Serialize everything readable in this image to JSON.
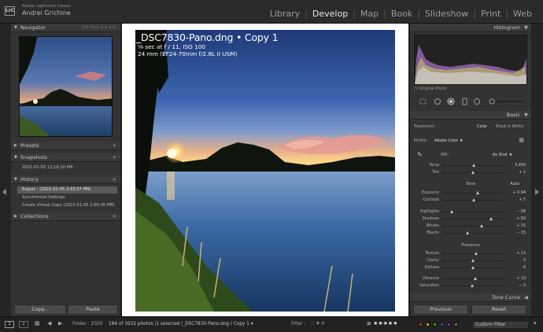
{
  "app": {
    "name": "Adobe Lightroom Classic",
    "user": "Andrei Grichine",
    "logo": "LrC"
  },
  "modules": [
    {
      "label": "Library",
      "active": false
    },
    {
      "label": "Develop",
      "active": true
    },
    {
      "label": "Map",
      "active": false
    },
    {
      "label": "Book",
      "active": false
    },
    {
      "label": "Slideshow",
      "active": false
    },
    {
      "label": "Print",
      "active": false
    },
    {
      "label": "Web",
      "active": false
    }
  ],
  "left": {
    "navigator": {
      "title": "Navigator",
      "options": "FIT   FILL   1:1   4:1"
    },
    "presets": {
      "title": "Presets"
    },
    "snapshots": {
      "title": "Snapshots",
      "items": [
        "2021-01-05 12:18:10 PM"
      ]
    },
    "history": {
      "title": "History",
      "items": [
        "Export - (2021-01-05 2:43:57 PM)",
        "Synchronize Settings",
        "Create Virtual Copy (2021-01-05 2:00:36 PM)"
      ]
    },
    "collections": {
      "title": "Collections"
    },
    "copy_label": "Copy...",
    "paste_label": "Paste"
  },
  "photo": {
    "line1": "_DSC7830-Pano.dng  •  Copy 1",
    "line2": "¹⁄₉ sec at f / 11, ISO 100",
    "line3": "24 mm (EF24-70mm f/2.8L II USM)"
  },
  "right": {
    "histogram": {
      "title": "Histogram",
      "iso": "ISO 100",
      "focal": "24 mm",
      "aperture": "f / 11",
      "shutter": "¹⁄₉ sec",
      "original": "Original Photo"
    },
    "basic": {
      "title": "Basic",
      "treatment_label": "Treatment :",
      "treatment_color": "Color",
      "treatment_bw": "Black & White",
      "profile_label": "Profile :",
      "profile_value": "Adobe Color ♦",
      "wb_label": "WB :",
      "wb_value": "As Shot ♦",
      "tone_label": "Tone",
      "auto_label": "Auto",
      "presence_label": "Presence",
      "sliders_wb": [
        {
          "label": "Temp",
          "value": "5,450",
          "pos": 0.52
        },
        {
          "label": "Tint",
          "value": "+ 2",
          "pos": 0.51
        }
      ],
      "sliders_tone": [
        {
          "label": "Exposure",
          "value": "+ 0.64",
          "pos": 0.58
        },
        {
          "label": "Contrast",
          "value": "+ 5",
          "pos": 0.52
        }
      ],
      "sliders_tone2": [
        {
          "label": "Highlights",
          "value": "− 68",
          "pos": 0.16
        },
        {
          "label": "Shadows",
          "value": "+ 60",
          "pos": 0.8
        },
        {
          "label": "Whites",
          "value": "+ 31",
          "pos": 0.65
        },
        {
          "label": "Blacks",
          "value": "− 15",
          "pos": 0.42
        }
      ],
      "sliders_presence": [
        {
          "label": "Texture",
          "value": "+ 12",
          "pos": 0.56
        },
        {
          "label": "Clarity",
          "value": "0",
          "pos": 0.5
        },
        {
          "label": "Dehaze",
          "value": "0",
          "pos": 0.5
        }
      ],
      "sliders_presence2": [
        {
          "label": "Vibrance",
          "value": "+ 10",
          "pos": 0.55
        },
        {
          "label": "Saturation",
          "value": "− 2",
          "pos": 0.49
        }
      ]
    },
    "tone_curve": {
      "title": "Tone Curve"
    },
    "previous_label": "Previous",
    "reset_label": "Reset"
  },
  "filmstrip": {
    "page1": "1",
    "page2": "2",
    "folder": "Folder : 2020",
    "info": "184 of 3932 photos /1 selected /_DSC7830-Pano.dng / Copy 1 ▾",
    "filter_label": "Filter :",
    "rating": "≥ ★★★★★",
    "custom_filter": "Custom Filter",
    "colors": [
      "#c03030",
      "#c0a020",
      "#30a030",
      "#3050c0",
      "#8030a0",
      "#707070"
    ]
  }
}
